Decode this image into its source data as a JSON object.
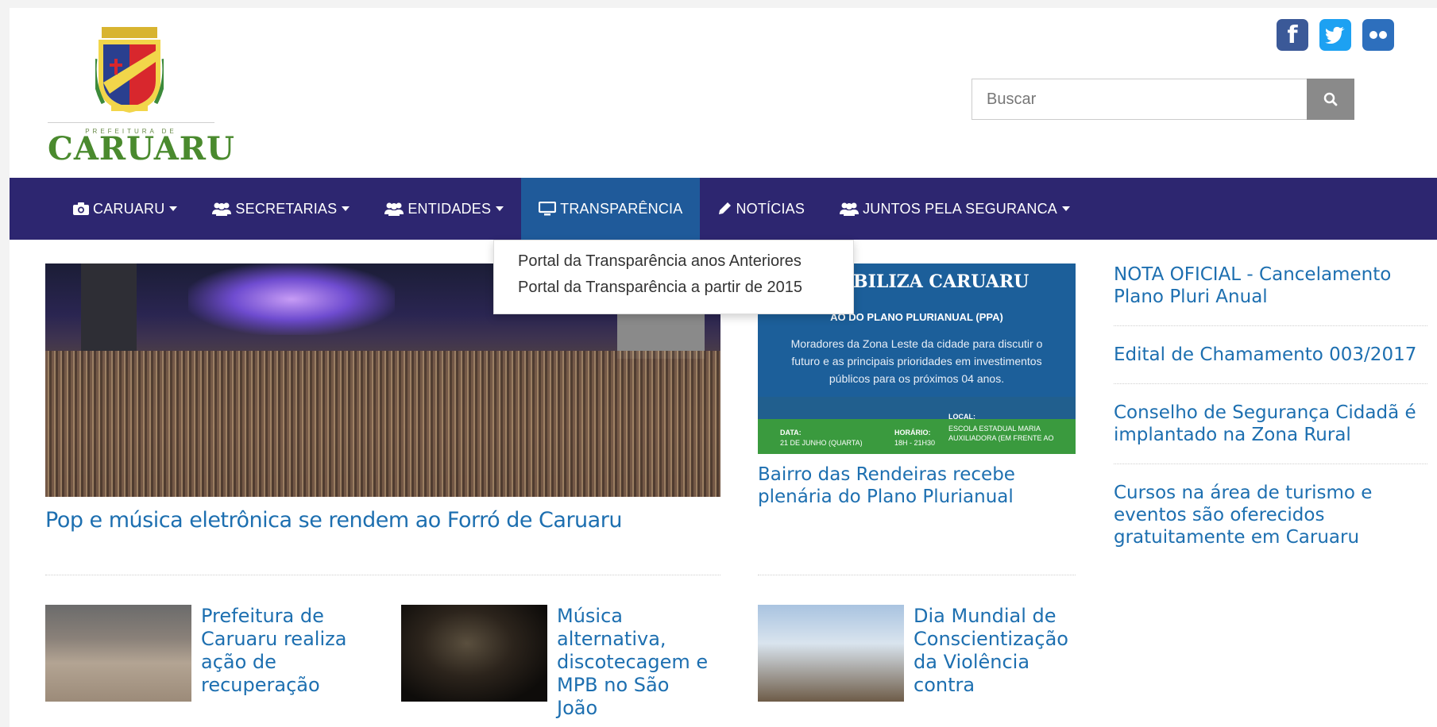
{
  "header": {
    "logo_prefix": "PREFEITURA DE",
    "logo_name": "CARUARU",
    "social": [
      {
        "name": "facebook-icon",
        "glyph": "f"
      },
      {
        "name": "twitter-icon",
        "glyph": ""
      },
      {
        "name": "flickr-icon",
        "glyph": ""
      }
    ],
    "search_placeholder": "Buscar"
  },
  "nav": {
    "items": [
      {
        "label": "CARUARU",
        "icon": "camera-icon",
        "dropdown": true
      },
      {
        "label": "SECRETARIAS",
        "icon": "users-icon",
        "dropdown": true
      },
      {
        "label": "ENTIDADES",
        "icon": "users-icon",
        "dropdown": true
      },
      {
        "label": "TRANSPARÊNCIA",
        "icon": "monitor-icon",
        "dropdown": false,
        "active": true
      },
      {
        "label": "NOTÍCIAS",
        "icon": "pencil-icon",
        "dropdown": false
      },
      {
        "label": "JUNTOS PELA SEGURANCA",
        "icon": "users-icon",
        "dropdown": true
      }
    ],
    "dropdown_items": [
      "Portal da Transparência anos Anteriores",
      "Portal da Transparência a partir de 2015"
    ]
  },
  "feature": {
    "title": "Pop e música eletrônica se rendem ao Forró de Caruaru"
  },
  "banner": {
    "title": "BILIZA CARUARU",
    "subtitle": "ÃO DO PLANO PLURIANUAL (PPA)",
    "body": "Moradores da Zona Leste da cidade para discutir o futuro e as principais prioridades em investimentos públicos para os próximos 04 anos.",
    "data_label": "DATA:",
    "data_value": "21 DE JUNHO (QUARTA)",
    "horario_label": "HORÁRIO:",
    "horario_value": "18H - 21H30",
    "local_label": "LOCAL:",
    "local_value": "ESCOLA ESTADUAL MARIA AUXILIADORA (EM FRENTE AO",
    "caption": "Bairro das Rendeiras recebe plenária do Plano Plurianual"
  },
  "sidebar": {
    "items": [
      "NOTA OFICIAL - Cancelamento Plano Pluri Anual",
      "Edital de Chamamento 003/2017",
      "Conselho de Segurança Cidadã é implantado na Zona Rural",
      "Cursos na área de turismo e eventos são oferecidos gratuitamente em Caruaru"
    ]
  },
  "cards": [
    {
      "title": "Prefeitura de Caruaru realiza ação de recuperação"
    },
    {
      "title": "Música alternativa, discotecagem e MPB no São João"
    },
    {
      "title": "Dia Mundial de Conscientização da Violência contra"
    }
  ],
  "colors": {
    "nav_bg": "#2d2670",
    "nav_active": "#1f5a9a",
    "link": "#1d6fb0",
    "logo_green": "#4a8a2e"
  }
}
